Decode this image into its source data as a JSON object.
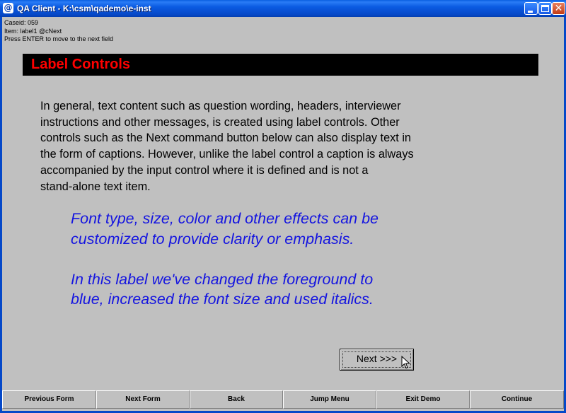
{
  "window": {
    "title": "QA Client - K:\\csm\\qademo\\e-inst",
    "icon": "qa-app-icon",
    "controls": [
      "minimize-icon",
      "maximize-icon",
      "close-icon"
    ]
  },
  "info": {
    "caseid": "Caseid: 059",
    "item": "Item: label1 @cNext",
    "hint": "Press ENTER to move to the next field"
  },
  "heading": {
    "title": "Label Controls",
    "color": "#ff0000",
    "background": "#000000"
  },
  "body_text": {
    "lines": [
      "In general, text content such as question wording, headers, interviewer",
      "instructions and other messages, is created using label controls.  Other",
      "controls such as the Next command button below can also display text in",
      "the form of captions.  However, unlike the label control a caption is always",
      "accompanied by the input control where it is defined and is not a",
      "stand-alone text item."
    ]
  },
  "emphasis_text": {
    "color": "#1414e0",
    "block1": [
      "Font type, size, color and other effects can be",
      "customized to provide clarity or emphasis."
    ],
    "block2": [
      "In this label we've changed the foreground to",
      "blue, increased the font size and used italics."
    ]
  },
  "next_button": {
    "label": "Next >>>"
  },
  "bottom_bar": {
    "buttons": [
      "Previous Form",
      "Next Form",
      "Back",
      "Jump Menu",
      "Exit Demo",
      "Continue"
    ]
  }
}
